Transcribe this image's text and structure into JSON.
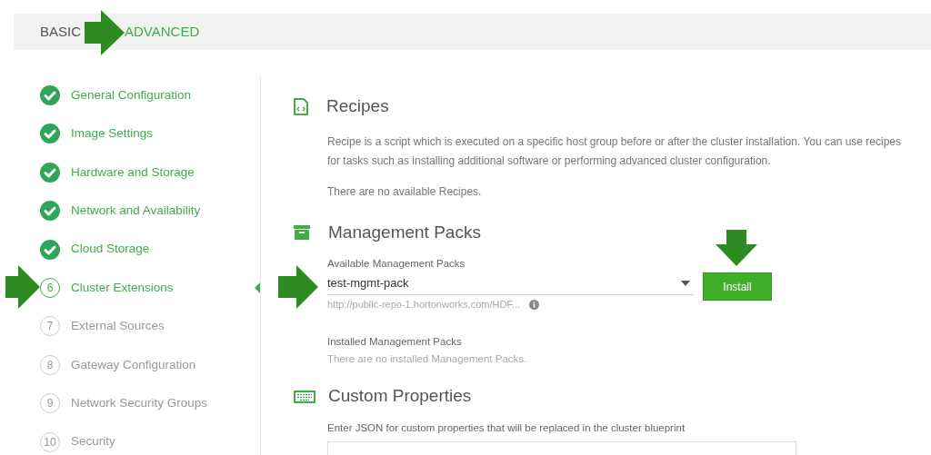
{
  "mode_tabs": [
    {
      "label": "BASIC",
      "selected": false
    },
    {
      "label": "ADVANCED",
      "selected": true
    }
  ],
  "steps": [
    {
      "label": "General Configuration",
      "done": true,
      "selected": false
    },
    {
      "label": "Image Settings",
      "done": true,
      "selected": false
    },
    {
      "label": "Hardware and Storage",
      "done": true,
      "selected": false
    },
    {
      "label": "Network and Availability",
      "done": true,
      "selected": false
    },
    {
      "label": "Cloud Storage",
      "done": true,
      "selected": false
    },
    {
      "number": "6",
      "label": "Cluster Extensions",
      "done": false,
      "selected": true
    },
    {
      "number": "7",
      "label": "External Sources",
      "done": false,
      "selected": false
    },
    {
      "number": "8",
      "label": "Gateway Configuration",
      "done": false,
      "selected": false
    },
    {
      "number": "9",
      "label": "Network Security Groups",
      "done": false,
      "selected": false
    },
    {
      "number": "10",
      "label": "Security",
      "done": false,
      "selected": false
    }
  ],
  "recipes": {
    "title": "Recipes",
    "description": "Recipe is a script which is executed on a specific host group before or after the cluster installation. You can use recipes for tasks such as installing additional software or performing advanced cluster configuration.",
    "empty_text": "There are no available Recipes."
  },
  "management_packs": {
    "title": "Management Packs",
    "field_label": "Available Management Packs",
    "value": "test-mgmt-pack",
    "url": "http://public-repo-1.hortonworks.com/HDF...",
    "button": "Install",
    "installed_label": "Installed Management Packs",
    "installed_empty": "There are no installed Management Packs."
  },
  "custom_properties": {
    "title": "Custom Properties",
    "field_label": "Enter JSON for custom properties that will be replaced in the cluster blueprint"
  }
}
